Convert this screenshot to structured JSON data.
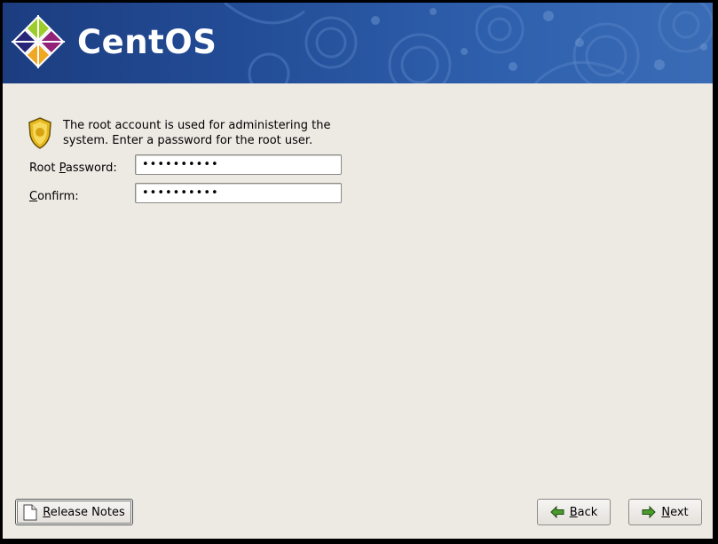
{
  "banner": {
    "logo_text": "CentOS",
    "logo_icon": "centos-logo-icon"
  },
  "intro": {
    "icon": "shield-icon",
    "text_line1": "The root account is used for administering the",
    "text_line2": "system.  Enter a password for the root user."
  },
  "form": {
    "root_password_label_pre": "Root ",
    "root_password_label_key": "P",
    "root_password_label_post": "assword:",
    "root_password_value": "••••••••••",
    "confirm_label_key": "C",
    "confirm_label_post": "onfirm:",
    "confirm_value": "••••••••••"
  },
  "buttons": {
    "release_notes_key": "R",
    "release_notes_rest": "elease Notes",
    "release_notes_icon": "document-icon",
    "back_key": "B",
    "back_rest": "ack",
    "back_icon": "back-arrow-icon",
    "next_key": "N",
    "next_rest": "ext",
    "next_icon": "next-arrow-icon"
  },
  "colors": {
    "banner": "#234d97",
    "background": "#edeae4",
    "arrow_green": "#3f8f2a"
  }
}
